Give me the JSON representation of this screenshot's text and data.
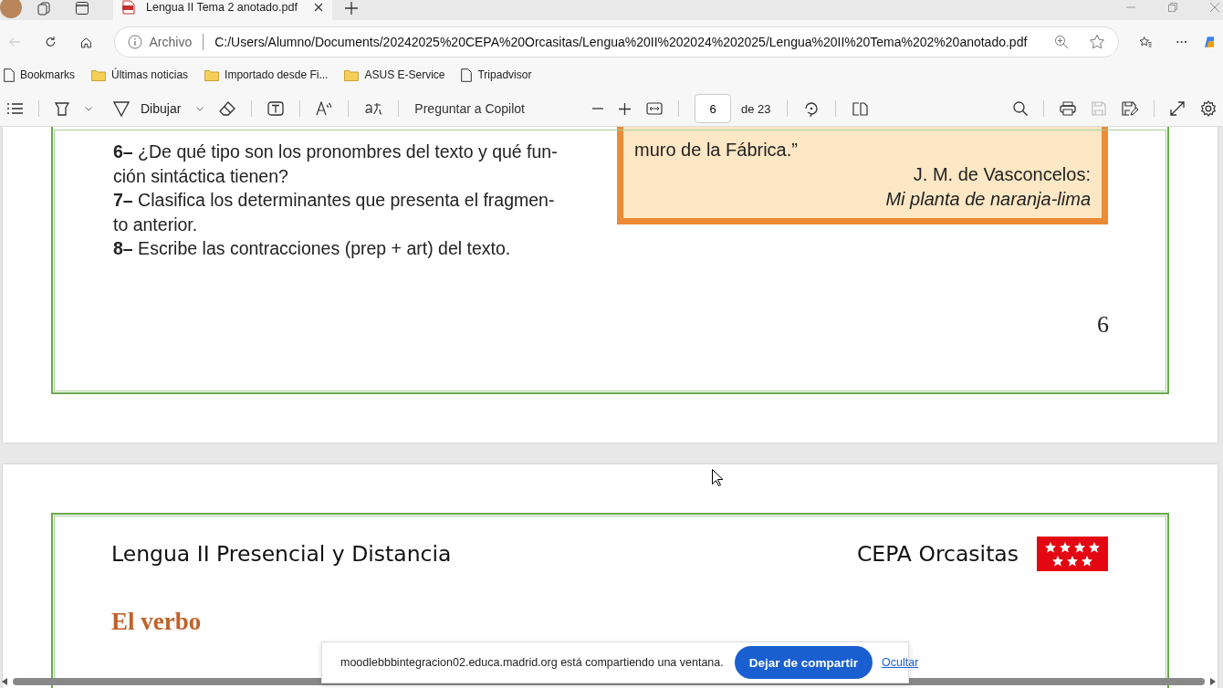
{
  "browser": {
    "tab": {
      "title": "Lengua II Tema 2 anotado.pdf"
    },
    "address": {
      "label": "Archivo",
      "url": "C:/Users/Alumno/Documents/20242025%20CEPA%20Orcasitas/Lengua%20II%202024%202025/Lengua%20II%20Tema%202%20anotado.pdf"
    },
    "bookmarks": [
      {
        "label": "Bookmarks",
        "kind": "page"
      },
      {
        "label": "Últimas noticias",
        "kind": "folder"
      },
      {
        "label": "Importado desde Fi...",
        "kind": "folder"
      },
      {
        "label": "ASUS E-Service",
        "kind": "folder"
      },
      {
        "label": "Tripadvisor",
        "kind": "page"
      }
    ]
  },
  "pdf_toolbar": {
    "draw_label": "Dibujar",
    "copilot_label": "Preguntar a Copilot",
    "page": "6",
    "page_count": "de 23"
  },
  "page_6": {
    "questions": [
      {
        "lines": [
          "**6–** ¿De qué tipo son los pronombres del texto y qué fun-",
          "ción sintáctica tienen?"
        ]
      },
      {
        "lines": [
          "**7–** Clasifica los determinantes que presenta el fragmen-",
          "to anterior."
        ]
      },
      {
        "lines": [
          "**8–** Escribe las contracciones (prep + art) del texto."
        ]
      }
    ],
    "quote": {
      "text": "muro de la Fábrica.”",
      "author": "J. M. de Vasconcelos:",
      "work": "Mi planta de naranja-lima"
    },
    "page_number": "6"
  },
  "page_7": {
    "header_title": "Lengua II Presencial y Distancia",
    "school": "CEPA Orcasitas",
    "heading": "El verbo"
  },
  "share_banner": {
    "message": "moodlebbbintegracion02.educa.madrid.org está compartiendo una ventana.",
    "stop_button": "Dejar de compartir",
    "hide_link": "Ocultar"
  }
}
